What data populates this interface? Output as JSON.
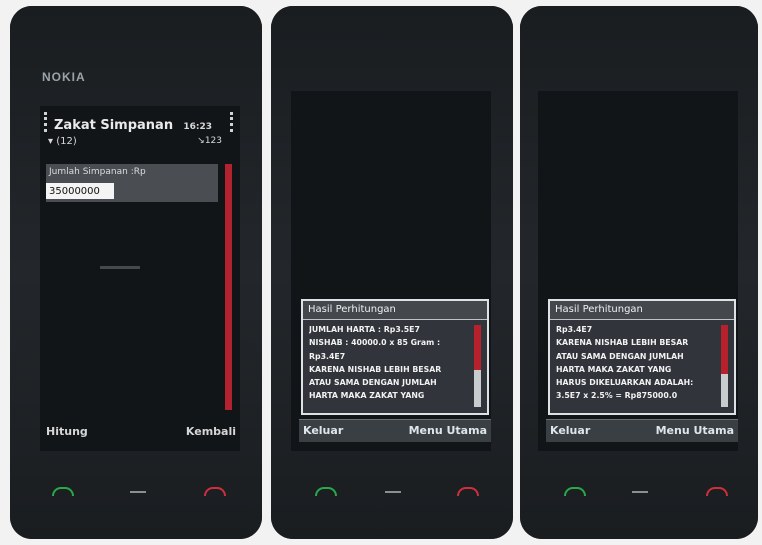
{
  "phone1": {
    "brand": "NOKIA",
    "app_title": "Zakat Simpanan",
    "message_count": "(12)",
    "clock": "16:23",
    "network": "123",
    "field_label": "Jumlah Simpanan :Rp",
    "field_value": "35000000",
    "softkey_left": "Hitung",
    "softkey_right": "Kembali"
  },
  "phone2": {
    "dialog_title": "Hasil Perhitungan",
    "lines": [
      "JUMLAH HARTA : Rp3.5E7",
      "NISHAB : 40000.0 x 85 Gram :",
      "Rp3.4E7",
      "KARENA NISHAB LEBIH BESAR",
      "ATAU SAMA DENGAN JUMLAH",
      "HARTA MAKA ZAKAT YANG"
    ],
    "scroll_level": 0.55,
    "button_left": "Keluar",
    "button_right": "Menu Utama"
  },
  "phone3": {
    "dialog_title": "Hasil Perhitungan",
    "lines": [
      "Rp3.4E7",
      "KARENA NISHAB LEBIH BESAR",
      "ATAU SAMA DENGAN JUMLAH",
      "HARTA MAKA ZAKAT YANG",
      "HARUS DIKELUARKAN ADALAH:",
      "3.5E7 x 2.5% = Rp875000.0"
    ],
    "scroll_level": 0.6,
    "button_left": "Keluar",
    "button_right": "Menu Utama"
  },
  "colors": {
    "accent_red": "#b2232f",
    "call_green": "#2aa84a",
    "end_red": "#cf2f3c"
  }
}
